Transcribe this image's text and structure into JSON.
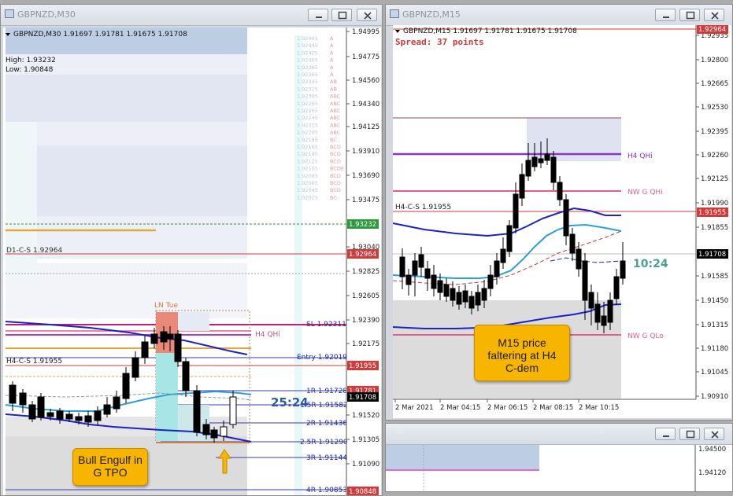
{
  "left_window": {
    "title": "GBPNZD,M30",
    "header": "GBPNZD,M30  1.91697 1.91781 1.91675 1.91708",
    "high_label": "High: 1.93232",
    "low_label": "Low: 1.90848",
    "price_axis": [
      "1.94995",
      "1.94775",
      "1.94560",
      "1.94340",
      "1.94125",
      "1.93910",
      "1.93690",
      "1.93475",
      "1.93040",
      "1.92825",
      "1.92605",
      "1.92390",
      "1.92175",
      "1.91520",
      "1.91305",
      "1.91090"
    ],
    "price_tags": {
      "high": "1.93232",
      "d1cs": "1.92964",
      "h4cs": "1.91955",
      "r1": "1.91781",
      "current": "1.91708",
      "low": "1.90848"
    },
    "labels": {
      "d1cs": "D1-C-S 1.92964",
      "h4cs": "H4-C-S 1.91955",
      "ln_tue": "LN Tue",
      "h4_qhi": "H4 QHi",
      "sl": "SL 1.92311",
      "entry": "Entry 1.92019",
      "r1": "1R 1.91728",
      "r15": "1.5R 1.91582",
      "r2": "2R 1.91436",
      "r25": "2.5R 1.91290",
      "r3": "3R 1.91144",
      "r4": "4R 1.90853",
      "timer": "25:24"
    },
    "tpo_levels": [
      "1.92465",
      "1.92445",
      "1.92425",
      "1.92405",
      "1.92385",
      "1.92365",
      "1.92345",
      "1.92325",
      "1.92305",
      "1.92285",
      "1.92265",
      "1.92245",
      "1.92225",
      "1.92205",
      "1.92185",
      "1.92165",
      "1.92145",
      "1.92125",
      "1.92105",
      "1.92085",
      "1.92065",
      "1.92045",
      "1.92025"
    ],
    "tpo_letters": [
      "A",
      "A",
      "A",
      "A",
      "A",
      "A",
      "AB",
      "AB",
      "ABC",
      "ABC",
      "ABC",
      "ABC",
      "ABC",
      "ABC",
      "BC",
      "BCD",
      "BCD",
      "BCD",
      "BCDE",
      "BCD",
      "BCD",
      "BCD",
      "BC"
    ]
  },
  "right_window": {
    "title": "GBPNZD,M15",
    "header": "GBPNZD,M15  1.91697 1.91781 1.91675 1.91708",
    "spread": "Spread: 37 points",
    "price_axis": [
      "1.92935",
      "1.92800",
      "1.92665",
      "1.92530",
      "1.92395",
      "1.92260",
      "1.92125",
      "1.91990",
      "1.91855",
      "1.91585",
      "1.91450",
      "1.91315",
      "1.91180",
      "1.91045",
      "1.90910"
    ],
    "price_tags": {
      "top": "1.92964",
      "h4cs": "1.91955",
      "current": "1.91708"
    },
    "labels": {
      "h4_qhi": "H4 QHi",
      "nw_g_qhi": "NW G QHi",
      "nw_g_qlo": "NW G QLo",
      "h4cs": "H4-C-S 1.91955",
      "timer": "10:24"
    },
    "time_axis": [
      "2 Mar 2021",
      "2 Mar 04:15",
      "2 Mar 06:15",
      "2 Mar 08:15",
      "2 Mar 10:15"
    ]
  },
  "bottom_window": {
    "title": "",
    "price_axis": [
      "1.94500",
      "1.94120"
    ]
  },
  "callouts": {
    "bull_engulf": "Bull Engulf in G TPO",
    "m15_price": "M15 price faltering at H4 C-dem"
  },
  "colors": {
    "bull": "#ffffff",
    "bear": "#000000",
    "blue_line": "#1d22c8",
    "cyan_line": "#2d9fd8",
    "red_level": "#d23a3a",
    "purple_level": "#8a35c8",
    "pink_level": "#e0608a",
    "orange_level": "#e6a63a",
    "callout": "#f7b500"
  }
}
